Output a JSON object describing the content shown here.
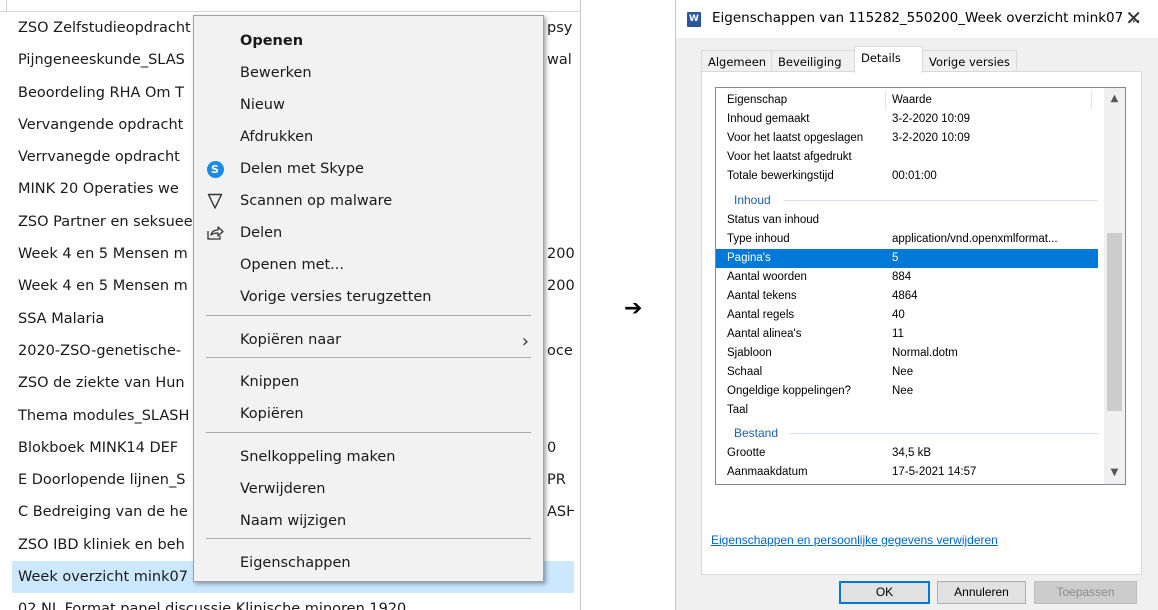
{
  "explorer": {
    "files": [
      {
        "name": "ZSO Zelfstudieopdracht",
        "tail": "psy"
      },
      {
        "name": "Pijngeneeskunde_SLAS",
        "tail": "wal"
      },
      {
        "name": "Beoordeling RHA Om T",
        "tail": ""
      },
      {
        "name": "Vervangende opdracht",
        "tail": ""
      },
      {
        "name": "Verrvanegde opdracht",
        "tail": ""
      },
      {
        "name": "MINK 20  Operaties we",
        "tail": ""
      },
      {
        "name": "ZSO Partner en seksuee",
        "tail": ""
      },
      {
        "name": "Week 4 en 5 Mensen m",
        "tail": "200"
      },
      {
        "name": "Week 4 en 5 Mensen m",
        "tail": "200"
      },
      {
        "name": "SSA Malaria",
        "tail": ""
      },
      {
        "name": "2020-ZSO-genetische-",
        "tail": "oce"
      },
      {
        "name": "ZSO de ziekte van Hun",
        "tail": ""
      },
      {
        "name": "Thema modules_SLASH",
        "tail": ""
      },
      {
        "name": "Blokboek MINK14 DEF",
        "tail": "0"
      },
      {
        "name": "E Doorlopende lijnen_S",
        "tail": "PR"
      },
      {
        "name": "C Bedreiging van de he",
        "tail": "ASH"
      },
      {
        "name": "ZSO IBD kliniek en beh",
        "tail": ""
      },
      {
        "name": "Week overzicht mink07",
        "tail": ""
      },
      {
        "name": "02 NL Format panel discussie Klinische minoren 1920",
        "tail": ""
      }
    ],
    "selected_index": 17
  },
  "context_menu": {
    "items": [
      {
        "label": "Openen",
        "bold": true,
        "icon": ""
      },
      {
        "label": "Bewerken",
        "icon": ""
      },
      {
        "label": "Nieuw",
        "icon": ""
      },
      {
        "label": "Afdrukken",
        "icon": ""
      },
      {
        "label": "Delen met Skype",
        "icon": "skype-icon"
      },
      {
        "label": "Scannen op malware",
        "icon": "shield-icon"
      },
      {
        "label": "Delen",
        "icon": "share-icon"
      },
      {
        "label": "Openen met...",
        "icon": ""
      },
      {
        "label": "Vorige versies terugzetten",
        "icon": ""
      },
      {
        "label": "Kopiëren naar",
        "icon": "",
        "submenu": true
      },
      {
        "label": "Knippen",
        "icon": ""
      },
      {
        "label": "Kopiëren",
        "icon": ""
      },
      {
        "label": "Snelkoppeling maken",
        "icon": ""
      },
      {
        "label": "Verwijderen",
        "icon": ""
      },
      {
        "label": "Naam wijzigen",
        "icon": ""
      },
      {
        "label": "Eigenschappen",
        "icon": ""
      }
    ],
    "submenu_glyph": "›",
    "skype_letter": "S"
  },
  "arrow": "➔",
  "dialog": {
    "title": "Eigenschappen van 115282_550200_Week overzicht mink07 ...",
    "icon_letter": "W",
    "close_glyph": "✕",
    "tabs": [
      "Algemeen",
      "Beveiliging",
      "Details",
      "Vorige versies"
    ],
    "active_tab": 2,
    "header": {
      "key": "Eigenschap",
      "value": "Waarde"
    },
    "rows_a": [
      {
        "k": "Inhoud gemaakt",
        "v": "3-2-2020 10:09"
      },
      {
        "k": "Voor het laatst opgeslagen",
        "v": "3-2-2020 10:09"
      },
      {
        "k": "Voor het laatst afgedrukt",
        "v": ""
      },
      {
        "k": "Totale bewerkingstijd",
        "v": "00:01:00"
      }
    ],
    "group_inhoud": "Inhoud",
    "rows_b": [
      {
        "k": "Status van inhoud",
        "v": ""
      },
      {
        "k": "Type inhoud",
        "v": "application/vnd.openxmlformat..."
      },
      {
        "k": "Pagina's",
        "v": "5",
        "highlight": true
      },
      {
        "k": "Aantal woorden",
        "v": "884"
      },
      {
        "k": "Aantal tekens",
        "v": "4864"
      },
      {
        "k": "Aantal regels",
        "v": "40"
      },
      {
        "k": "Aantal alinea's",
        "v": "11"
      },
      {
        "k": "Sjabloon",
        "v": "Normal.dotm"
      },
      {
        "k": "Schaal",
        "v": "Nee"
      },
      {
        "k": "Ongeldige koppelingen?",
        "v": "Nee"
      },
      {
        "k": "Taal",
        "v": ""
      }
    ],
    "group_bestand": "Bestand",
    "rows_c": [
      {
        "k": "Grootte",
        "v": "34,5 kB"
      },
      {
        "k": "Aanmaakdatum",
        "v": "17-5-2021 14:57"
      }
    ],
    "scroll_up": "▲",
    "scroll_down": "▼",
    "remove_link": "Eigenschappen en persoonlijke gegevens verwijderen",
    "buttons": {
      "ok": "OK",
      "cancel": "Annuleren",
      "apply": "Toepassen"
    }
  },
  "colors": {
    "selection": "#cce8ff",
    "highlight": "#0078d7",
    "group": "#1e5eab",
    "link": "#0066cc"
  }
}
